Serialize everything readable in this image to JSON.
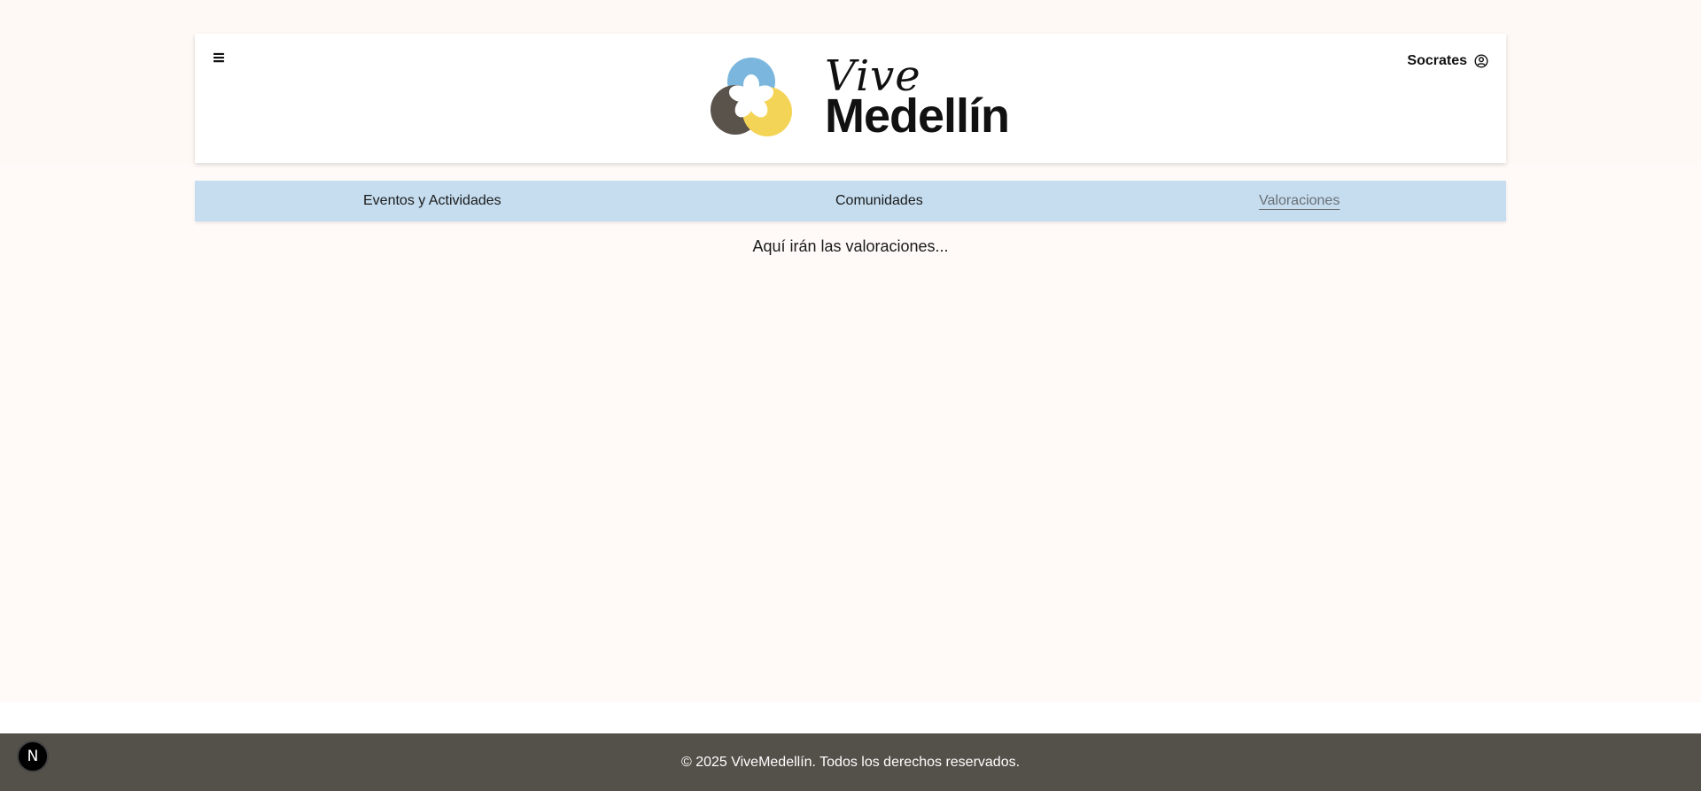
{
  "header": {
    "menu_icon": "menu-icon",
    "menu_glyph": "≡",
    "logo": {
      "line1": "Vive",
      "line2": "Medellín"
    },
    "user": {
      "name": "Socrates",
      "icon": "user-circle-icon"
    }
  },
  "nav": {
    "tabs": [
      {
        "label": "Eventos y Actividades",
        "active": false
      },
      {
        "label": "Comunidades",
        "active": false
      },
      {
        "label": "Valoraciones",
        "active": true
      }
    ]
  },
  "main": {
    "placeholder": "Aquí irán las valoraciones..."
  },
  "footer": {
    "text": "© 2025 ViveMedellín. Todos los derechos reservados."
  },
  "dev_badge": {
    "letter": "N",
    "icon": "nextjs-icon"
  },
  "colors": {
    "page_bg": "#fffaf8",
    "nav_bg": "#c5ddef",
    "footer_bg": "#54504a",
    "logo_blue": "#7ab6de",
    "logo_yellow": "#f4d457",
    "logo_gray": "#5a534b",
    "active_tab": "#6a6f75"
  }
}
